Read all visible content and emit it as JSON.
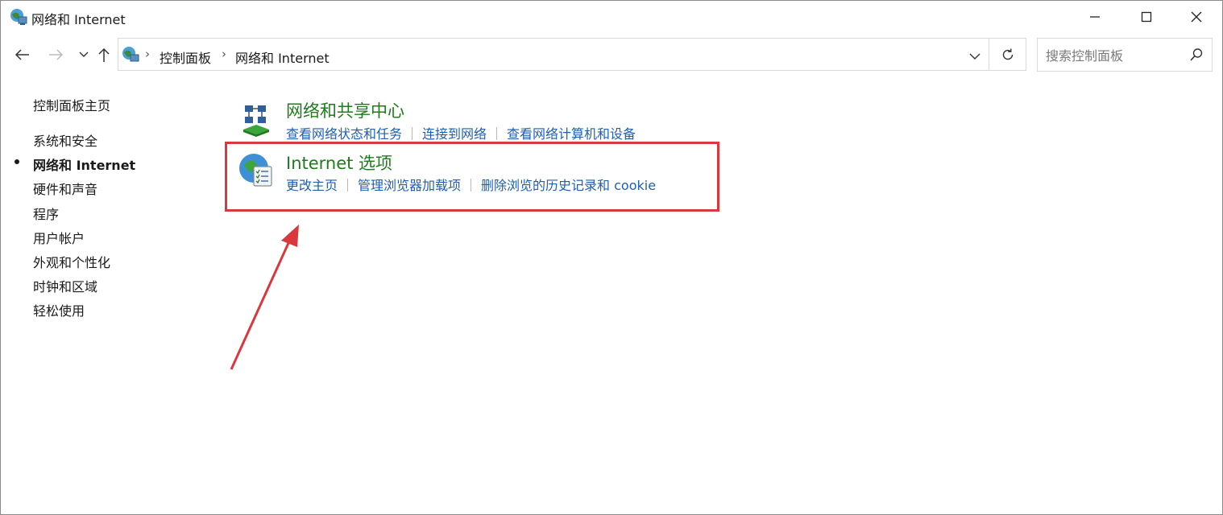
{
  "window": {
    "title": "网络和 Internet"
  },
  "window_controls": {
    "minimize_icon": "minimize-icon",
    "maximize_icon": "maximize-icon",
    "close_icon": "close-icon"
  },
  "address_bar": {
    "breadcrumb": [
      "控制面板",
      "网络和 Internet"
    ],
    "separator": "›"
  },
  "search": {
    "placeholder": "搜索控制面板"
  },
  "sidebar": {
    "home": "控制面板主页",
    "items": [
      {
        "label": "系统和安全",
        "active": false
      },
      {
        "label": "网络和 Internet",
        "active": true
      },
      {
        "label": "硬件和声音",
        "active": false
      },
      {
        "label": "程序",
        "active": false
      },
      {
        "label": "用户帐户",
        "active": false
      },
      {
        "label": "外观和个性化",
        "active": false
      },
      {
        "label": "时钟和区域",
        "active": false
      },
      {
        "label": "轻松使用",
        "active": false
      }
    ]
  },
  "categories": [
    {
      "title": "网络和共享中心",
      "icon": "network-sharing-center-icon",
      "links": [
        "查看网络状态和任务",
        "连接到网络",
        "查看网络计算机和设备"
      ]
    },
    {
      "title": "Internet 选项",
      "icon": "internet-options-icon",
      "links": [
        "更改主页",
        "管理浏览器加载项",
        "删除浏览的历史记录和 cookie"
      ]
    }
  ],
  "annotation": {
    "highlight_color": "#d9393d"
  },
  "colors": {
    "category_title": "#1e7b1e",
    "link": "#1f5fae"
  }
}
